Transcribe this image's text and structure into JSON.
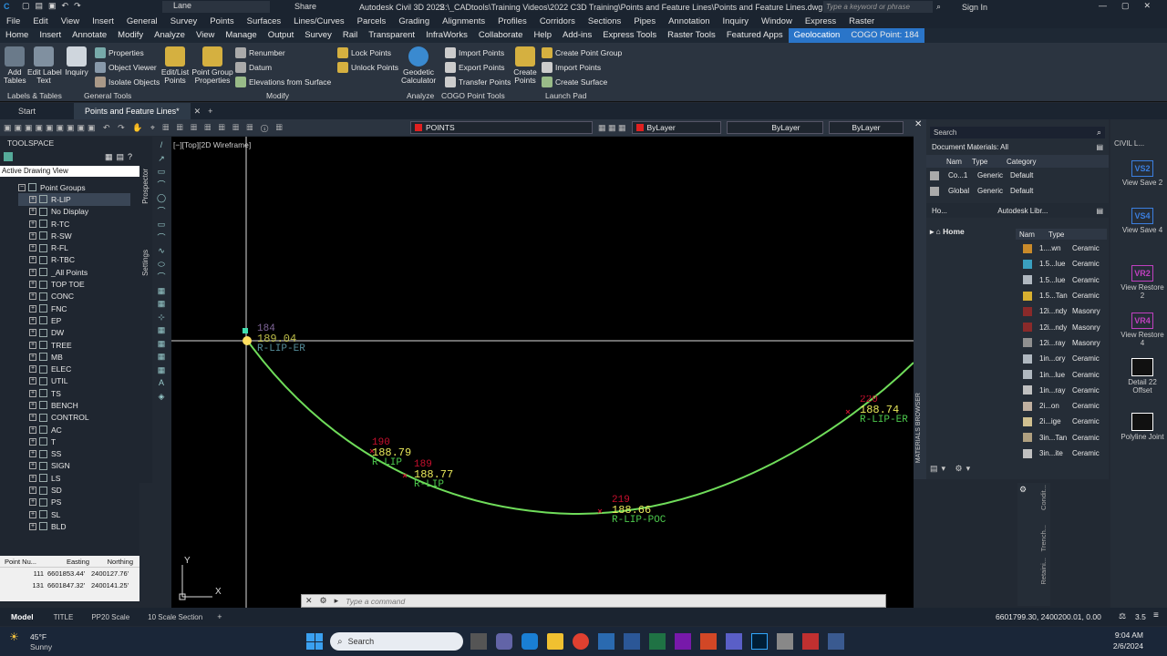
{
  "app": {
    "title": "Autodesk Civil 3D 2022",
    "path": "S:\\_CADtools\\Training Videos\\2022 C3D Training\\Points and Feature Lines\\Points and Feature Lines.dwg",
    "workspace": "Lane",
    "share": "Share",
    "search_placeholder": "Type a keyword or phrase",
    "signin": "Sign In"
  },
  "menu": [
    "File",
    "Edit",
    "View",
    "Insert",
    "General",
    "Survey",
    "Points",
    "Surfaces",
    "Lines/Curves",
    "Parcels",
    "Grading",
    "Alignments",
    "Profiles",
    "Corridors",
    "Sections",
    "Pipes",
    "Annotation",
    "Inquiry",
    "Window",
    "Express",
    "Raster"
  ],
  "tabs": [
    "Home",
    "Insert",
    "Annotate",
    "Modify",
    "Analyze",
    "View",
    "Manage",
    "Output",
    "Survey",
    "Rail",
    "Transparent",
    "InfraWorks",
    "Collaborate",
    "Help",
    "Add-ins",
    "Express Tools",
    "Raster Tools",
    "Featured Apps",
    "Geolocation",
    "COGO Point: 184"
  ],
  "ribbon": {
    "add_tables": "Add\nTables",
    "edit_label_text": "Edit Label\nText",
    "inquiry": "Inquiry",
    "properties": "Properties",
    "object_viewer": "Object Viewer",
    "isolate_objects": "Isolate Objects",
    "edit_list_points": "Edit/List\nPoints",
    "point_group_properties": "Point Group\nProperties",
    "renumber": "Renumber",
    "datum": "Datum",
    "elevations_from_surface": "Elevations from Surface",
    "lock_points": "Lock Points",
    "unlock_points": "Unlock Points",
    "geodetic_calculator": "Geodetic\nCalculator",
    "import_points": "Import Points",
    "export_points": "Export Points",
    "transfer_points": "Transfer Points",
    "create_points": "Create\nPoints",
    "create_point_group": "Create Point Group",
    "import_points2": "Import Points",
    "create_surface": "Create Surface",
    "panels": [
      "Labels & Tables",
      "General Tools",
      "Modify",
      "Analyze",
      "COGO Point Tools",
      "Launch Pad"
    ]
  },
  "doctabs": [
    "Start",
    "Points and Feature Lines*"
  ],
  "quickbar": {
    "layer": "POINTS",
    "color": "ByLayer",
    "linetype": "ByLayer",
    "lineweight": "ByLayer"
  },
  "toolspace": {
    "title": "TOOLSPACE",
    "view": "Active Drawing View",
    "root": "Point Groups",
    "groups": [
      "R-LIP",
      "No Display",
      "R-TC",
      "R-SW",
      "R-FL",
      "R-TBC",
      "_All Points",
      "TOP TOE",
      "CONC",
      "FNC",
      "EP",
      "DW",
      "TREE",
      "MB",
      "ELEC",
      "UTIL",
      "TS",
      "BENCH",
      "CONTROL",
      "AC",
      "T",
      "SS",
      "SIGN",
      "LS",
      "SD",
      "PS",
      "SL",
      "BLD"
    ],
    "side_tabs": [
      "Prospector",
      "Settings"
    ],
    "table_headers": [
      "Point Nu...",
      "Easting",
      "Northing"
    ],
    "table_rows": [
      [
        "111",
        "6601853.44'",
        "2400127.76'"
      ],
      [
        "131",
        "6601847.32'",
        "2400141.25'"
      ]
    ]
  },
  "viewport": {
    "label": "[−][Top][2D Wireframe]",
    "y": "Y",
    "x": "X",
    "points": [
      {
        "num": "184",
        "elev": "189.04",
        "desc": "R-LIP-ER"
      },
      {
        "num": "190",
        "elev": "188.79",
        "desc": "R-LIP"
      },
      {
        "num": "189",
        "elev": "188.77",
        "desc": "R-LIP"
      },
      {
        "num": "219",
        "elev": "188.66",
        "desc": "R-LIP-POC"
      },
      {
        "num": "220",
        "elev": "188.74",
        "desc": "R-LIP-ER"
      }
    ]
  },
  "materials": {
    "search": "Search",
    "doc_materials": "Document Materials: All",
    "doc_headers": [
      "Nam",
      "Type",
      "Category"
    ],
    "doc_rows": [
      [
        "Co...1",
        "Generic",
        "Default"
      ],
      [
        "Global",
        "Generic",
        "Default"
      ]
    ],
    "lib_left": "Ho...",
    "lib_name": "Autodesk Libr...",
    "home": "Home",
    "lib_headers": [
      "Nam",
      "Type"
    ],
    "lib_rows": [
      [
        "1....wn",
        "Ceramic"
      ],
      [
        "1.5...lue",
        "Ceramic"
      ],
      [
        "1.5...lue",
        "Ceramic"
      ],
      [
        "1.5...Tan",
        "Ceramic"
      ],
      [
        "12i...ndy",
        "Masonry"
      ],
      [
        "12i...ndy",
        "Masonry"
      ],
      [
        "12i...ray",
        "Masonry"
      ],
      [
        "1in...ory",
        "Ceramic"
      ],
      [
        "1in...lue",
        "Ceramic"
      ],
      [
        "1in...ray",
        "Ceramic"
      ],
      [
        "2i...on",
        "Ceramic"
      ],
      [
        "2i...ige",
        "Ceramic"
      ],
      [
        "3in...Tan",
        "Ceramic"
      ],
      [
        "3in...ite",
        "Ceramic"
      ]
    ],
    "side_label": "MATERIALS BROWSER"
  },
  "viewsaves": {
    "header": "CIVIL L...",
    "items": [
      {
        "badge": "VS2",
        "label": "View Save 2",
        "color": "#3b7fe0"
      },
      {
        "badge": "VS4",
        "label": "View Save 4",
        "color": "#3b7fe0"
      },
      {
        "badge": "VR2",
        "label": "View Restore 2",
        "color": "#c040c0"
      },
      {
        "badge": "VR4",
        "label": "View Restore 4",
        "color": "#c040c0"
      },
      {
        "badge": "",
        "label": "Detail 22 Offset",
        "color": "#fff"
      },
      {
        "badge": "",
        "label": "Polyline Joint",
        "color": "#fff"
      }
    ]
  },
  "mini_tabs": [
    "Condit...",
    "Trench...",
    "Retaini..."
  ],
  "command": {
    "placeholder": "Type a command"
  },
  "status": {
    "tabs": [
      "Model",
      "TITLE",
      "PP20 Scale",
      "10 Scale Section"
    ],
    "coords": "6601799.30, 2400200.01, 0.00",
    "scale": "3.5"
  },
  "taskbar": {
    "temp": "45°F",
    "weather": "Sunny",
    "search": "Search",
    "time": "9:04 AM",
    "date": "2/6/2024"
  }
}
